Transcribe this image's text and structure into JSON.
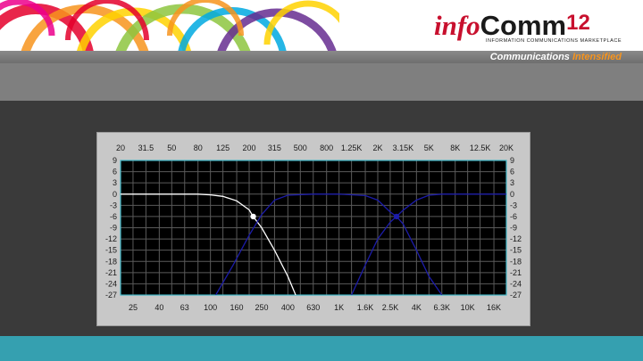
{
  "banner": {
    "logo_info": "info",
    "logo_comm": "Comm",
    "logo_num": "12",
    "logo_tagline": "INFORMATION COMMUNICATIONS MARKETPLACE",
    "tagline_main": "Communications ",
    "tagline_highlight": "Intensified",
    "swirl_colors": [
      "#e4002b",
      "#f7941d",
      "#ffd200",
      "#8dc63f",
      "#00a9e0",
      "#662d91",
      "#ec008c"
    ]
  },
  "colors": {
    "grid_bg": "#000000",
    "grid_line": "#5a5a5a",
    "frame_line": "#3fb6c6",
    "lowpass_curve": "#ffffff",
    "band_curves": "#1c1ca8",
    "bottom_bar": "#35a0b0"
  },
  "chart_data": {
    "type": "line",
    "x_scale": "log",
    "x_top_ticks": [
      "20",
      "31.5",
      "50",
      "80",
      "125",
      "200",
      "315",
      "500",
      "800",
      "1.25K",
      "2K",
      "3.15K",
      "5K",
      "8K",
      "12.5K",
      "20K"
    ],
    "x_bottom_ticks": [
      "25",
      "40",
      "63",
      "100",
      "160",
      "250",
      "400",
      "630",
      "1K",
      "1.6K",
      "2.5K",
      "4K",
      "6.3K",
      "10K",
      "16K"
    ],
    "y_ticks": [
      "9",
      "6",
      "3",
      "0",
      "-3",
      "-6",
      "-9",
      "-12",
      "-15",
      "-18",
      "-21",
      "-24",
      "-27"
    ],
    "ylim": [
      -27,
      9
    ],
    "xlim": [
      20,
      20000
    ],
    "series": [
      {
        "color": "white",
        "marker": {
          "x": 215,
          "y": -6
        },
        "points": [
          [
            20,
            0
          ],
          [
            80,
            0
          ],
          [
            100,
            -0.2
          ],
          [
            125,
            -0.6
          ],
          [
            160,
            -1.8
          ],
          [
            200,
            -4.2
          ],
          [
            215,
            -6
          ],
          [
            250,
            -9
          ],
          [
            315,
            -15
          ],
          [
            400,
            -22
          ],
          [
            460,
            -27
          ]
        ]
      },
      {
        "color": "blue",
        "points": [
          [
            110,
            -27
          ],
          [
            150,
            -19
          ],
          [
            200,
            -11
          ],
          [
            250,
            -5.5
          ],
          [
            315,
            -1.6
          ],
          [
            400,
            -0.3
          ],
          [
            630,
            0
          ],
          [
            1000,
            0
          ],
          [
            1600,
            -0.4
          ],
          [
            2000,
            -1.6
          ],
          [
            2500,
            -4.8
          ],
          [
            2800,
            -6
          ],
          [
            3150,
            -8
          ],
          [
            4000,
            -15
          ],
          [
            5000,
            -22
          ],
          [
            6300,
            -27
          ]
        ]
      },
      {
        "color": "blue",
        "marker": {
          "x": 2800,
          "y": -6
        },
        "points": [
          [
            1250,
            -27
          ],
          [
            1600,
            -19
          ],
          [
            2000,
            -12
          ],
          [
            2500,
            -7.5
          ],
          [
            2800,
            -6
          ],
          [
            3150,
            -4.3
          ],
          [
            4000,
            -1.6
          ],
          [
            5000,
            -0.3
          ],
          [
            6300,
            0
          ],
          [
            20000,
            0
          ]
        ]
      }
    ]
  }
}
